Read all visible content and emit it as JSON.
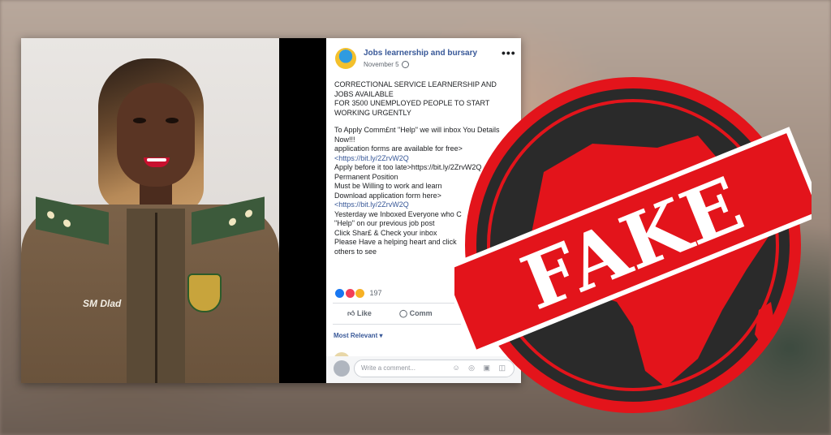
{
  "post": {
    "page_name": "Jobs learnership and bursary",
    "date": "November 5",
    "more": "•••",
    "lines": [
      "CORRECTIONAL SERVICE LEARNERSHIP AND",
      "JOBS AVAILABLE",
      "FOR 3500 UNEMPLOYED PEOPLE TO START",
      "WORKING URGENTLY",
      "To Apply Comm£nt \"Help\" we will inbox You Details",
      "Now!!!",
      "application forms are available for free>",
      "<https://bit.ly/2ZrvW2Q",
      "Apply before it too late>https://bit.ly/2ZrvW2Q",
      "Permanent Position",
      "Must be Willing to work and learn",
      "Download application form here>",
      "<https://bit.ly/2ZrvW2Q",
      "Yesterday we Inboxed Everyone who C",
      "\"Help\" on our previous job post",
      "Click Shar£ & Check your inbox",
      "Please Have a helping heart and click",
      "others to see"
    ],
    "reaction_count": "197",
    "like_label": "Like",
    "comment_label": "Comm",
    "most_relevant": "Most Relevant ▾",
    "comment_placeholder": "Write a comment...",
    "comment_icons": "☺ ◎ ▣ ◫"
  },
  "photo": {
    "name_tag": "SM Dlad"
  },
  "stamp": {
    "word": "FAKE",
    "color": "#e3141b"
  }
}
